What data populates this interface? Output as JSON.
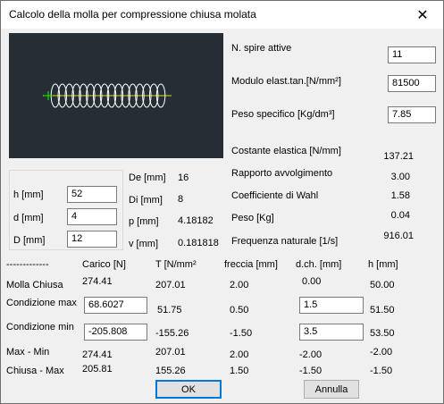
{
  "window": {
    "title": "Calcolo della molla per compressione chiusa molata",
    "close_glyph": "✕"
  },
  "preview": {
    "background": "#262e35",
    "spring_color": "#ffffff",
    "axis_color": "#d8d800",
    "marker_color": "#00ff00"
  },
  "geometry": {
    "h": {
      "label": "h [mm]",
      "value": "52"
    },
    "d": {
      "label": "d [mm]",
      "value": "4"
    },
    "D": {
      "label": "D [mm]",
      "value": "12"
    }
  },
  "derived": {
    "De": {
      "label": "De [mm]",
      "value": "16"
    },
    "Di": {
      "label": "Di [mm]",
      "value": "8"
    },
    "p": {
      "label": "p [mm]",
      "value": "4.18182"
    },
    "v": {
      "label": "v [mm]",
      "value": "0.181818"
    }
  },
  "params": {
    "spire": {
      "label": "N. spire attive",
      "value": "11"
    },
    "modulo": {
      "label": "Modulo elast.tan.[N/mm²]",
      "value": "81500"
    },
    "peso_spec": {
      "label": "Peso specifico [Kg/dm³]",
      "value": "7.85"
    }
  },
  "results": {
    "costante": {
      "label": "Costante elastica [N/mm]",
      "value": "137.21"
    },
    "rapporto": {
      "label": "Rapporto avvolgimento",
      "value": "3.00"
    },
    "wahl": {
      "label": "Coefficiente di Wahl",
      "value": "1.58"
    },
    "peso": {
      "label": "Peso [Kg]",
      "value": "0.04"
    },
    "frequenza": {
      "label": "Frequenza naturale [1/s]",
      "value": "916.01"
    }
  },
  "table": {
    "headers": [
      "-------------",
      "Carico [N]",
      "T [N/mm²",
      "freccia [mm]",
      "d.ch. [mm]",
      "h [mm]"
    ],
    "molla": {
      "label": "Molla   Chiusa",
      "carico": "274.41",
      "t": "207.01",
      "freccia": "2.00",
      "dch": "0.00",
      "h": "50.00"
    },
    "max": {
      "label": "Condizione max",
      "carico": "68.6027",
      "t": "51.75",
      "freccia": "0.50",
      "dch": "1.5",
      "h": "51.50"
    },
    "min": {
      "label": "Condizione min",
      "carico": "-205.808",
      "t": "-155.26",
      "freccia": "-1.50",
      "dch": "3.5",
      "h": "53.50"
    },
    "maxmin": {
      "label": "Max   -   Min",
      "carico": "274.41",
      "t": "207.01",
      "freccia": "2.00",
      "dch": "-2.00",
      "h": "-2.00"
    },
    "chiusa": {
      "label": "Chiusa  -  Max",
      "carico": "205.81",
      "t": "155.26",
      "freccia": "1.50",
      "dch": "-1.50",
      "h": "-1.50"
    }
  },
  "buttons": {
    "ok": "OK",
    "cancel": "Annulla"
  }
}
